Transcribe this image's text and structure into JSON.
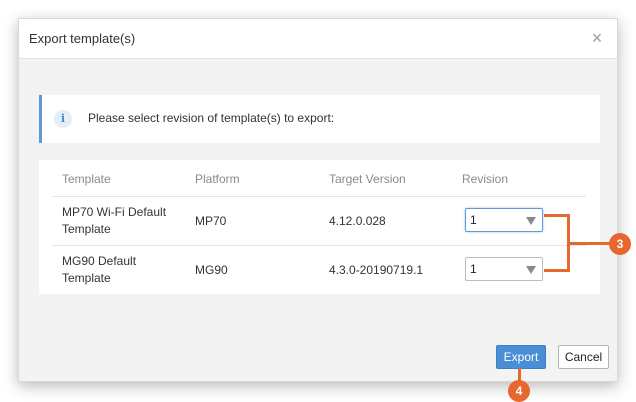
{
  "dialog": {
    "title": "Export template(s)",
    "close_glyph": "×"
  },
  "info": {
    "icon": "info-icon",
    "icon_glyph": "i",
    "message": "Please select revision of template(s) to export:"
  },
  "table": {
    "headers": [
      "Template",
      "Platform",
      "Target Version",
      "Revision"
    ],
    "rows": [
      {
        "template_line1": "MP70 Wi-Fi Default",
        "template_line2": "Template",
        "platform": "MP70",
        "target_version": "4.12.0.028",
        "revision": "1"
      },
      {
        "template_line1": "MG90 Default",
        "template_line2": "Template",
        "platform": "MG90",
        "target_version": "4.3.0-20190719.1",
        "revision": "1"
      }
    ]
  },
  "buttons": {
    "export": "Export",
    "cancel": "Cancel"
  },
  "annotations": {
    "marker_revision": "3",
    "marker_export": "4",
    "color": "#e8662f"
  },
  "colors": {
    "accent": "#4a8fd6",
    "info_border": "#5c9bd6"
  }
}
